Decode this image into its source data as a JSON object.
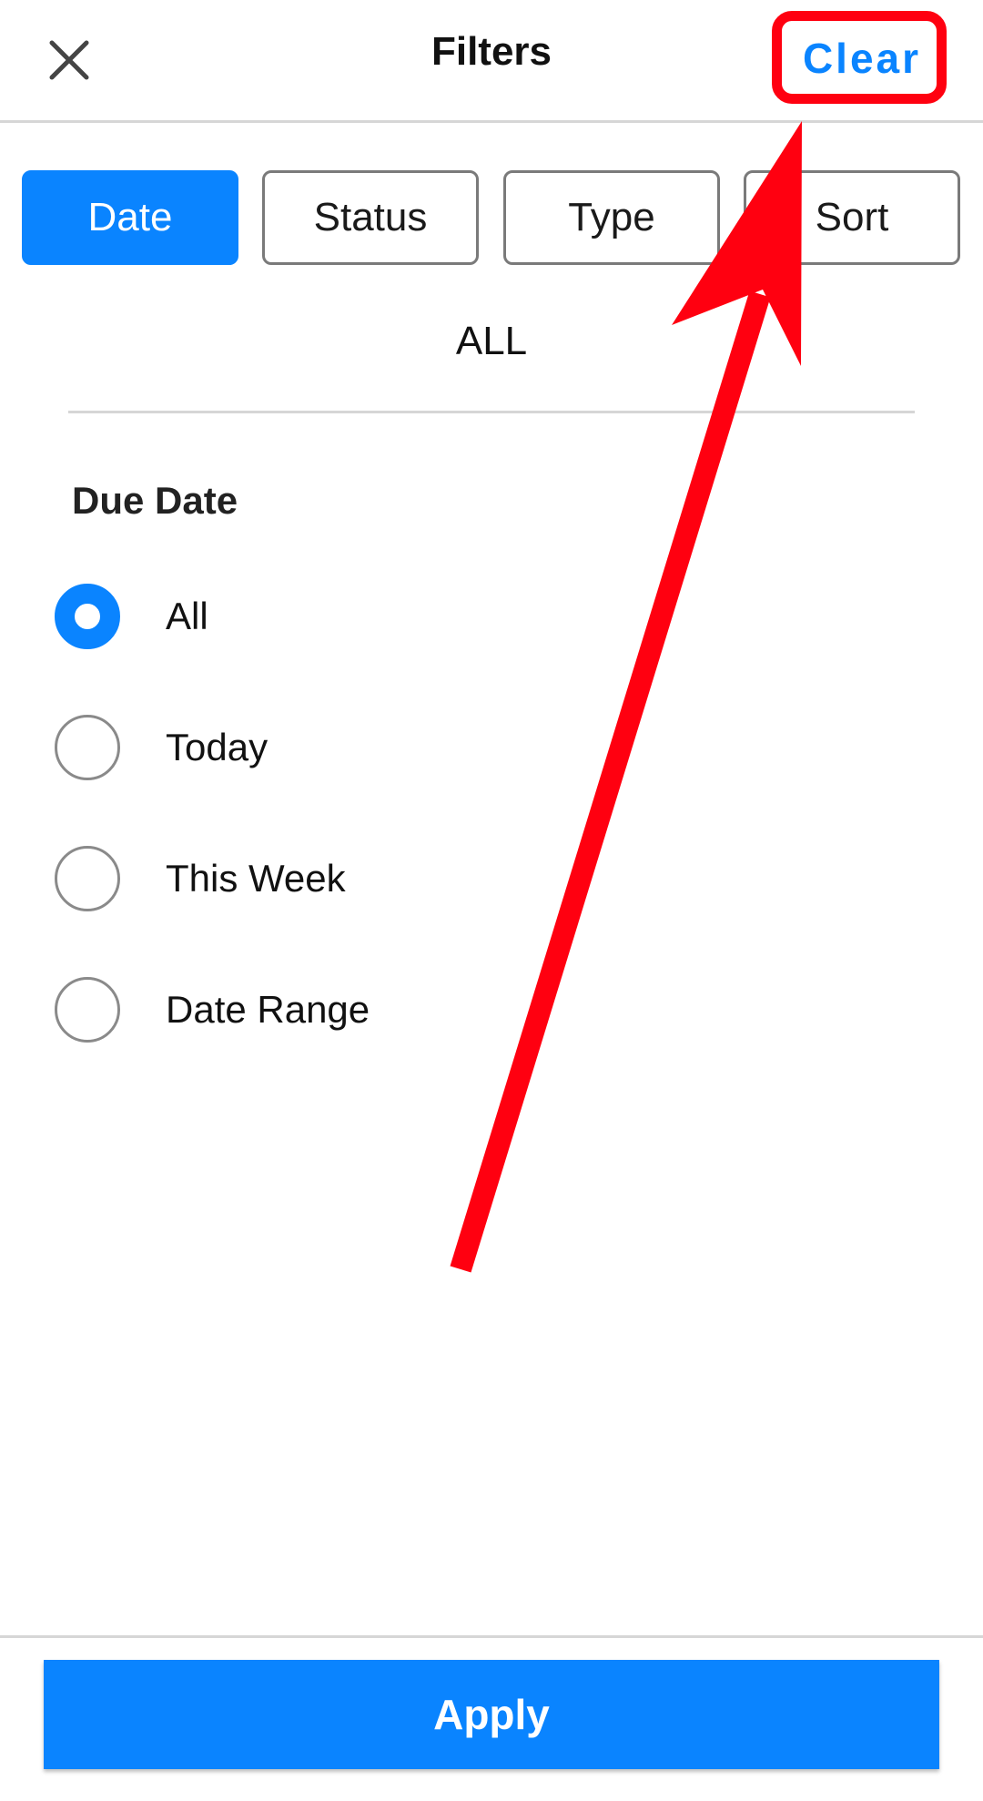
{
  "header": {
    "title": "Filters",
    "clear_label": "Clear",
    "close_icon": "close-icon"
  },
  "tabs": [
    {
      "label": "Date",
      "active": true
    },
    {
      "label": "Status",
      "active": false
    },
    {
      "label": "Type",
      "active": false
    },
    {
      "label": "Sort",
      "active": false
    }
  ],
  "summary": "ALL",
  "due_date": {
    "title": "Due Date",
    "options": [
      {
        "label": "All",
        "selected": true
      },
      {
        "label": "Today",
        "selected": false
      },
      {
        "label": "This Week",
        "selected": false
      },
      {
        "label": "Date Range",
        "selected": false
      }
    ]
  },
  "apply_label": "Apply",
  "colors": {
    "accent": "#0a84ff",
    "annotation": "#ff0010"
  }
}
